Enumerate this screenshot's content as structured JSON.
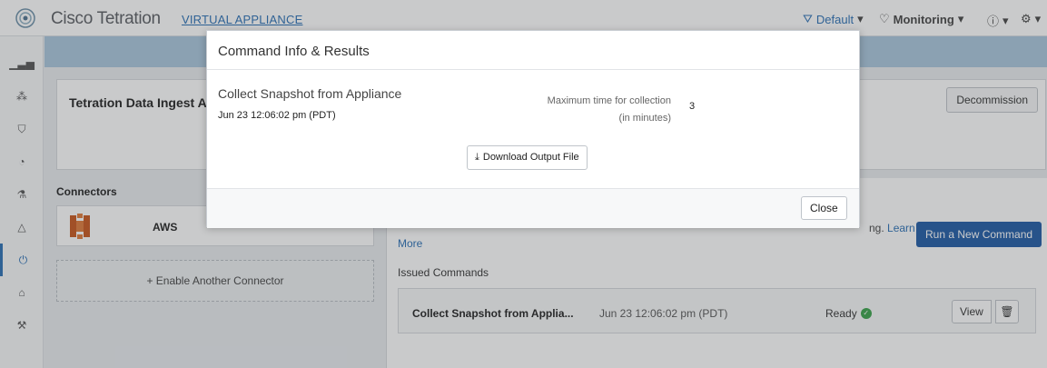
{
  "header": {
    "brand": "Cisco Tetration",
    "appliance_label": "VIRTUAL APPLIANCE",
    "scope_label": "Default",
    "monitoring_label": "Monitoring",
    "help_caret": "▾",
    "settings_caret": "▾"
  },
  "nav": {
    "icons": [
      "dashboard-icon",
      "topology-icon",
      "shield-icon",
      "gauge-icon",
      "flask-icon",
      "alerts-icon",
      "plug-icon",
      "institution-icon",
      "wrench-icon"
    ]
  },
  "main": {
    "card_title": "Tetration Data Ingest A",
    "decommission_label": "Decommission"
  },
  "connectors": {
    "title": "Connectors",
    "aws_label": "AWS",
    "enable_label": "+ Enable Another Connector"
  },
  "commands": {
    "more_link": "More",
    "learn_text": "ng.",
    "learn_link": "Learn",
    "run_label": "Run a New Command",
    "issued_label": "Issued Commands",
    "rows": [
      {
        "name": "Collect Snapshot from Applia...",
        "date": "Jun 23 12:06:02 pm (PDT)",
        "status": "Ready",
        "view_label": "View"
      }
    ]
  },
  "modal": {
    "title": "Command Info & Results",
    "command_name": "Collect Snapshot from Appliance",
    "command_date": "Jun 23 12:06:02 pm (PDT)",
    "max_time_line1": "Maximum time for collection",
    "max_time_line2": "(in minutes)",
    "max_time_value": "3",
    "download_label": "Download Output File",
    "close_label": "Close"
  },
  "colors": {
    "accent": "#1f5aa6",
    "link": "#2a6fb5",
    "status_ok": "#3aa34a"
  }
}
